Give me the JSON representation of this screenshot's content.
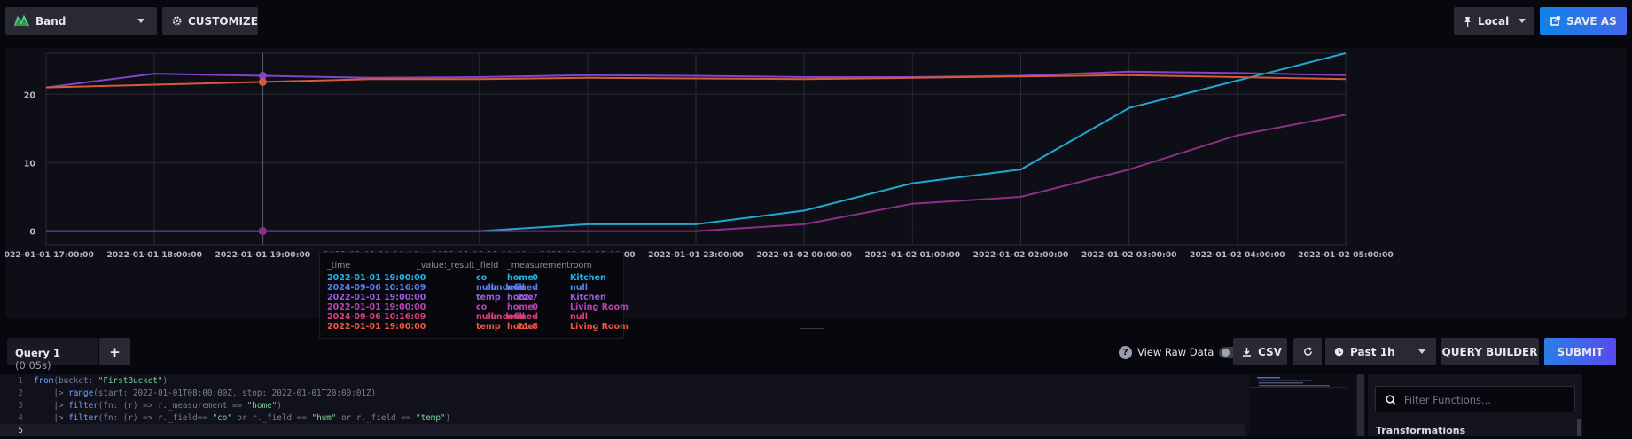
{
  "toolbar": {
    "view_type": "Band",
    "customize": "CUSTOMIZE",
    "timezone": "Local",
    "save_as": "SAVE AS"
  },
  "colors": {
    "background": "#07070e",
    "panel": "#0e0e17",
    "accent_blue": "#0f83e6",
    "series_co_kitchen": "#22a7cf",
    "series_co_living": "#8d2f86",
    "series_temp_kitchen": "#8244c9",
    "series_temp_living": "#d45a3a"
  },
  "chart_data": {
    "type": "line",
    "x": [
      "2022-01-01 17:00:00",
      "2022-01-01 18:00:00",
      "2022-01-01 19:00:00",
      "2022-01-01 20:00:00",
      "2022-01-01 21:00:00",
      "2022-01-01 22:00:00",
      "2022-01-01 23:00:00",
      "2022-01-02 00:00:00",
      "2022-01-02 01:00:00",
      "2022-01-02 02:00:00",
      "2022-01-02 03:00:00",
      "2022-01-02 04:00:00",
      "2022-01-02 05:00:00"
    ],
    "yticks": [
      0,
      10,
      20
    ],
    "ylim": [
      -2,
      26
    ],
    "series": [
      {
        "name": "co Kitchen",
        "color": "#22a7cf",
        "values": [
          0,
          0,
          0,
          0,
          0,
          1,
          1,
          3,
          7,
          9,
          18,
          22,
          26
        ]
      },
      {
        "name": "co Living Room",
        "color": "#8d2f86",
        "values": [
          0,
          0,
          0,
          0,
          0,
          0,
          0,
          1,
          4,
          5,
          9,
          14,
          17
        ]
      },
      {
        "name": "temp Kitchen",
        "color": "#8244c9",
        "values": [
          21.0,
          23.0,
          22.7,
          22.4,
          22.5,
          22.8,
          22.7,
          22.5,
          22.5,
          22.7,
          23.3,
          23.1,
          22.8
        ]
      },
      {
        "name": "temp Living Room",
        "color": "#d45a3a",
        "values": [
          21.0,
          21.4,
          21.8,
          22.2,
          22.2,
          22.4,
          22.3,
          22.2,
          22.4,
          22.6,
          22.8,
          22.5,
          22.2
        ]
      }
    ],
    "hover_index": 2
  },
  "tooltip": {
    "headers": [
      "_time",
      "_value:_result",
      "_field",
      "_measurement",
      "room"
    ],
    "rows": [
      {
        "time": "2022-01-01 19:00:00",
        "value": "0",
        "field": "co",
        "measurement": "home",
        "room": "Kitchen",
        "color": "#22b3ea"
      },
      {
        "time": "2024-09-06 10:16:09",
        "value": "undefined",
        "field": "null",
        "measurement": "null",
        "room": "null",
        "color": "#5a7ef0"
      },
      {
        "time": "2022-01-01 19:00:00",
        "value": "22.7",
        "field": "temp",
        "measurement": "home",
        "room": "Kitchen",
        "color": "#9b5be0"
      },
      {
        "time": "2022-01-01 19:00:00",
        "value": "0",
        "field": "co",
        "measurement": "home",
        "room": "Living Room",
        "color": "#b843b5"
      },
      {
        "time": "2024-09-06 10:16:09",
        "value": "undefined",
        "field": "null",
        "measurement": "null",
        "room": "null",
        "color": "#d8407a"
      },
      {
        "time": "2022-01-01 19:00:00",
        "value": "21.8",
        "field": "temp",
        "measurement": "home",
        "room": "Living Room",
        "color": "#f0573c"
      }
    ]
  },
  "query": {
    "tab_label": "Query 1",
    "tab_time": "(0.05s)",
    "add": "+",
    "view_raw": "View Raw Data",
    "csv": "CSV",
    "time_range": "Past 1h",
    "query_builder": "QUERY BUILDER",
    "submit": "SUBMIT"
  },
  "editor": {
    "line_numbers": [
      "1",
      "2",
      "3",
      "4",
      "5"
    ],
    "lines": [
      [
        {
          "t": "from",
          "c": "kw"
        },
        {
          "t": "(bucket: ",
          "c": ""
        },
        {
          "t": "\"FirstBucket\"",
          "c": "str"
        },
        {
          "t": ")",
          "c": ""
        }
      ],
      [
        {
          "t": "    |> ",
          "c": ""
        },
        {
          "t": "range",
          "c": "kw"
        },
        {
          "t": "(start: 2022-01-01T08:00:00Z, stop: 2022-01-01T20:00:01Z)",
          "c": ""
        }
      ],
      [
        {
          "t": "    |> ",
          "c": ""
        },
        {
          "t": "filter",
          "c": "kw"
        },
        {
          "t": "(fn: (r) => r._measurement == ",
          "c": ""
        },
        {
          "t": "\"home\"",
          "c": "str"
        },
        {
          "t": ")",
          "c": ""
        }
      ],
      [
        {
          "t": "    |> ",
          "c": ""
        },
        {
          "t": "filter",
          "c": "kw"
        },
        {
          "t": "(fn: (r) => r._field== ",
          "c": ""
        },
        {
          "t": "\"co\"",
          "c": "str"
        },
        {
          "t": " or r._field == ",
          "c": ""
        },
        {
          "t": "\"hum\"",
          "c": "str"
        },
        {
          "t": " or r._field == ",
          "c": ""
        },
        {
          "t": "\"temp\"",
          "c": "str"
        },
        {
          "t": ")",
          "c": ""
        }
      ],
      []
    ]
  },
  "functions": {
    "search_placeholder": "Filter Functions...",
    "section": "Transformations"
  }
}
